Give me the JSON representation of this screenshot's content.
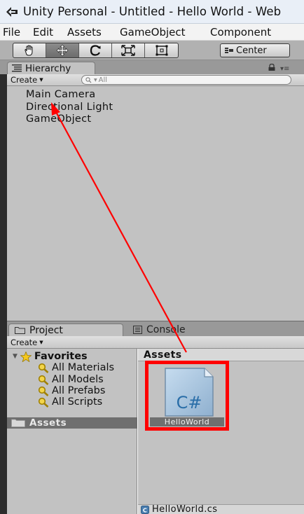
{
  "window": {
    "title": "Unity Personal - Untitled - Hello World - Web"
  },
  "menu": {
    "items": [
      "File",
      "Edit",
      "Assets",
      "GameObject",
      "Component"
    ]
  },
  "toolbar": {
    "tools": [
      "hand-tool",
      "move-tool",
      "rotate-tool",
      "scale-tool",
      "rect-tool"
    ],
    "pivot_label": "Center"
  },
  "hierarchy": {
    "tab_label": "Hierarchy",
    "create_label": "Create",
    "search_placeholder": "All",
    "items": [
      "Main Camera",
      "Directional Light",
      "GameObject"
    ]
  },
  "project": {
    "tab_label": "Project",
    "console_tab_label": "Console",
    "create_label": "Create",
    "favorites_label": "Favorites",
    "favorites": [
      "All Materials",
      "All Models",
      "All Prefabs",
      "All Scripts"
    ],
    "assets_folder_label": "Assets",
    "assets_header": "Assets",
    "asset_name": "HelloWorld",
    "asset_glyph": "C#",
    "status_file": "HelloWorld.cs"
  },
  "annotations": {
    "highlight_color": "#ff0000",
    "arrow_color": "#ff0000"
  }
}
